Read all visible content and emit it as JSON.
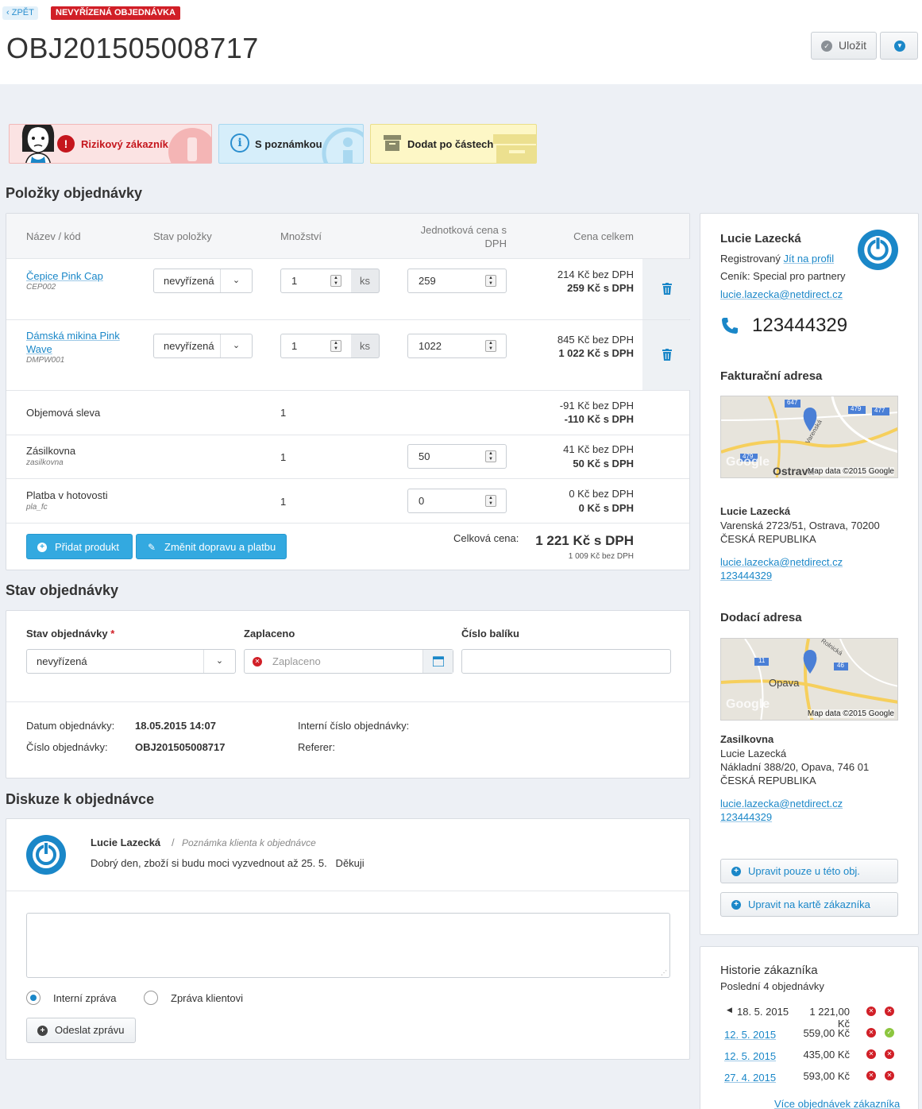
{
  "header": {
    "back_label": "ZPĚT",
    "status_tag": "NEVYŘÍZENÁ OBJEDNÁVKA",
    "order_number": "OBJ201505008717",
    "save_label": "Uložit"
  },
  "flags": [
    {
      "label": "Rizikový zákazník",
      "color": "#c5161d"
    },
    {
      "label": "S poznámkou"
    },
    {
      "label": "Dodat po částech"
    }
  ],
  "items_section": {
    "title": "Položky objednávky",
    "columns": [
      "Název / kód",
      "Stav položky",
      "Množství",
      "Jednotková cena s DPH",
      "Cena celkem"
    ],
    "items": [
      {
        "name": "Čepice Pink Cap",
        "code": "CEP002",
        "state": "nevyřízená",
        "qty": "1",
        "unit": "ks",
        "unit_price": "259",
        "price_net": "214 Kč bez DPH",
        "price_gross": "259 Kč s DPH"
      },
      {
        "name": "Dámská mikina Pink Wave",
        "code": "DMPW001",
        "state": "nevyřízená",
        "qty": "1",
        "unit": "ks",
        "unit_price": "1022",
        "price_net": "845 Kč bez DPH",
        "price_gross": "1 022 Kč s DPH"
      }
    ],
    "extras": [
      {
        "name": "Objemová sleva",
        "code": "",
        "qty": "1",
        "unit_price": "",
        "price_net": "-91 Kč bez DPH",
        "price_gross": "-110 Kč s DPH"
      },
      {
        "name": "Zásilkovna",
        "code": "zasilkovna",
        "qty": "1",
        "unit_price": "50",
        "price_net": "41 Kč bez DPH",
        "price_gross": "50 Kč s DPH"
      },
      {
        "name": "Platba v hotovosti",
        "code": "pla_fc",
        "qty": "1",
        "unit_price": "0",
        "price_net": "0 Kč bez DPH",
        "price_gross": "0 Kč s DPH"
      }
    ],
    "add_product_label": "Přidat produkt",
    "change_shipping_label": "Změnit dopravu a platbu",
    "total_label": "Celková cena:",
    "total_gross": "1 221 Kč s DPH",
    "total_net": "1 009 Kč bez DPH"
  },
  "status_section": {
    "title": "Stav objednávky",
    "state_label": "Stav objednávky",
    "required_mark": "*",
    "state_value": "nevyřízená",
    "paid_label": "Zaplaceno",
    "paid_placeholder": "Zaplaceno",
    "package_label": "Číslo balíku",
    "package_value": "",
    "date_label": "Datum objednávky:",
    "date_value": "18.05.2015 14:07",
    "number_label": "Číslo objednávky:",
    "number_value": "OBJ201505008717",
    "internal_label": "Interní číslo objednávky:",
    "referer_label": "Referer:"
  },
  "discussion": {
    "title": "Diskuze k objednávce",
    "author": "Lucie Lazecká",
    "separator": "/",
    "note_type": "Poznámka klienta k objednávce",
    "message": "Dobrý den, zboží si budu moci vyzvednout až 25. 5.   Děkuji",
    "textarea_value": "",
    "radio_internal": "Interní zpráva",
    "radio_client": "Zpráva klientovi",
    "send_label": "Odeslat zprávu"
  },
  "customer": {
    "name": "Lucie Lazecká",
    "registered_label": "Registrovaný",
    "profile_link": "Jít na profil",
    "pricelist": "Ceník: Special pro partnery",
    "email": "lucie.lazecka@netdirect.cz",
    "phone": "123444329",
    "billing_title": "Fakturační adresa",
    "billing_map_credit": "Map data ©2015 Google",
    "billing_map_city": "Ostrava",
    "billing_map_street": "Varenská",
    "billing_map_roads": [
      "647",
      "479",
      "477",
      "479"
    ],
    "billing_name": "Lucie Lazecká",
    "billing_street": "Varenská 2723/51, Ostrava, 70200",
    "billing_country": "ČESKÁ REPUBLIKA",
    "billing_email": "lucie.lazecka@netdirect.cz",
    "billing_phone": "123444329",
    "delivery_title": "Dodací adresa",
    "delivery_map_credit": "Map data ©2015 Google",
    "delivery_map_city": "Opava",
    "delivery_map_street": "Rolnická",
    "delivery_map_roads": [
      "11",
      "46"
    ],
    "map_watermark": "Google",
    "delivery_company": "Zasilkovna",
    "delivery_name": "Lucie Lazecká",
    "delivery_street": "Nákladní 388/20, Opava, 746 01",
    "delivery_country": "ČESKÁ REPUBLIKA",
    "delivery_email": "lucie.lazecka@netdirect.cz",
    "delivery_phone": "123444329",
    "edit_order_only": "Upravit pouze u této obj.",
    "edit_customer_card": "Upravit na kartě zákazníka"
  },
  "history": {
    "title": "Historie zákazníka",
    "subtitle": "Poslední 4 objednávky",
    "orders": [
      {
        "date": "18. 5. 2015",
        "amount": "1 221,00 Kč",
        "current": true,
        "s1": "red",
        "s2": "red"
      },
      {
        "date": "12. 5. 2015",
        "amount": "559,00 Kč",
        "current": false,
        "s1": "red",
        "s2": "green"
      },
      {
        "date": "12. 5. 2015",
        "amount": "435,00 Kč",
        "current": false,
        "s1": "red",
        "s2": "red"
      },
      {
        "date": "27. 4. 2015",
        "amount": "593,00 Kč",
        "current": false,
        "s1": "red",
        "s2": "red"
      }
    ],
    "more_link": "Více objednávek zákazníka"
  },
  "colors": {
    "accent": "#1a87c8",
    "button_blue": "#33a9e0",
    "status_red": "#d11f27",
    "status_green": "#8cc63f"
  }
}
